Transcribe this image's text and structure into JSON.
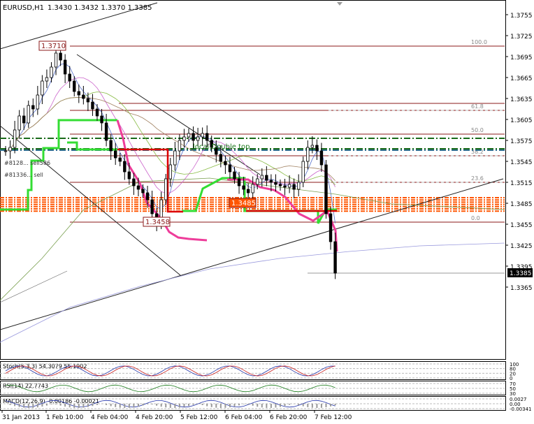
{
  "header": {
    "symbol": "EURUSD,H1",
    "ohlc": "1.3430 1.3432 1.3370 1.3385"
  },
  "colors": {
    "background": "#ffffff",
    "candle": "#000000",
    "fib_line": "#8b1a1a",
    "green_band": "#33dd33",
    "pink_band": "#ee3d9a",
    "red_level": "#dd0000",
    "orange_zone": "#ff5500",
    "dashed_green": "#1a6b1a",
    "dashed_teal": "#2f6f8f",
    "annotation_green": "#1f7a1f"
  },
  "chart_data": {
    "type": "line",
    "title": "EURUSD,H1",
    "ylim": [
      1.3352,
      1.3775
    ],
    "price_ticks": [
      "1.3755",
      "1.3725",
      "1.3695",
      "1.3665",
      "1.3635",
      "1.3605",
      "1.3575",
      "1.3545",
      "1.3515",
      "1.3485",
      "1.3455",
      "1.3425",
      "1.3395",
      "1.3365"
    ],
    "time_ticks": [
      "31 Jan 2013",
      "1 Feb 10:00",
      "4 Feb 04:00",
      "4 Feb 20:00",
      "5 Feb 12:00",
      "6 Feb 04:00",
      "6 Feb 20:00",
      "7 Feb 12:00"
    ],
    "current_price": "1.3385",
    "close_series": [
      1.356,
      1.3565,
      1.359,
      1.361,
      1.36,
      1.3625,
      1.362,
      1.364,
      1.366,
      1.3665,
      1.368,
      1.37,
      1.369,
      1.367,
      1.366,
      1.3645,
      1.364,
      1.3635,
      1.363,
      1.362,
      1.361,
      1.36,
      1.3575,
      1.356,
      1.355,
      1.3545,
      1.353,
      1.352,
      1.351,
      1.3505,
      1.35,
      1.349,
      1.347,
      1.3458,
      1.349,
      1.352,
      1.354,
      1.356,
      1.3575,
      1.358,
      1.3585,
      1.3575,
      1.358,
      1.3585,
      1.3575,
      1.3565,
      1.3555,
      1.3545,
      1.354,
      1.353,
      1.352,
      1.351,
      1.3505,
      1.35,
      1.3512,
      1.352,
      1.3525,
      1.3518,
      1.3515,
      1.3512,
      1.351,
      1.3508,
      1.3512,
      1.3505,
      1.3515,
      1.3545,
      1.3565,
      1.3568,
      1.356,
      1.354,
      1.347,
      1.343,
      1.3385
    ],
    "fib_levels": [
      {
        "label": "100.0",
        "price": 1.371
      },
      {
        "label": "61.8",
        "price": 1.3618
      },
      {
        "label": "50.0",
        "price": 1.3584
      },
      {
        "label": "38.2",
        "price": 1.3553
      },
      {
        "label": "23.6",
        "price": 1.3515
      },
      {
        "label": "0.0",
        "price": 1.3458
      }
    ],
    "extra_levels": [
      1.3628,
      1.3584
    ],
    "price_boxes": [
      {
        "label": "1.3710",
        "price": 1.371
      },
      {
        "label": "1.3458",
        "price": 1.3458
      },
      {
        "label": "1.3485",
        "price": 1.3485
      }
    ],
    "order_labels": [
      "#8128... sell586",
      "#81336... sell"
    ],
    "dash_green_levels": [
      1.3578,
      1.3563
    ],
    "dash_teal_level": 1.3561,
    "orange_zone": [
      1.3472,
      1.3493
    ],
    "annotations": [
      "local Double top"
    ]
  },
  "indicators": [
    {
      "id": "stoch",
      "label": "Stoch(5,3,3) 54.3079 55.1902",
      "ticks": [
        "100",
        "80",
        "20",
        "0"
      ]
    },
    {
      "id": "rsi",
      "label": "RSI(14) 22.7743",
      "ticks": [
        "70",
        "50",
        "30"
      ]
    },
    {
      "id": "macd",
      "label": "MACD(12,26,9) -0.00186 -0.00021",
      "ticks": [
        "0.0027",
        "0.00",
        "-0.00341"
      ]
    }
  ]
}
